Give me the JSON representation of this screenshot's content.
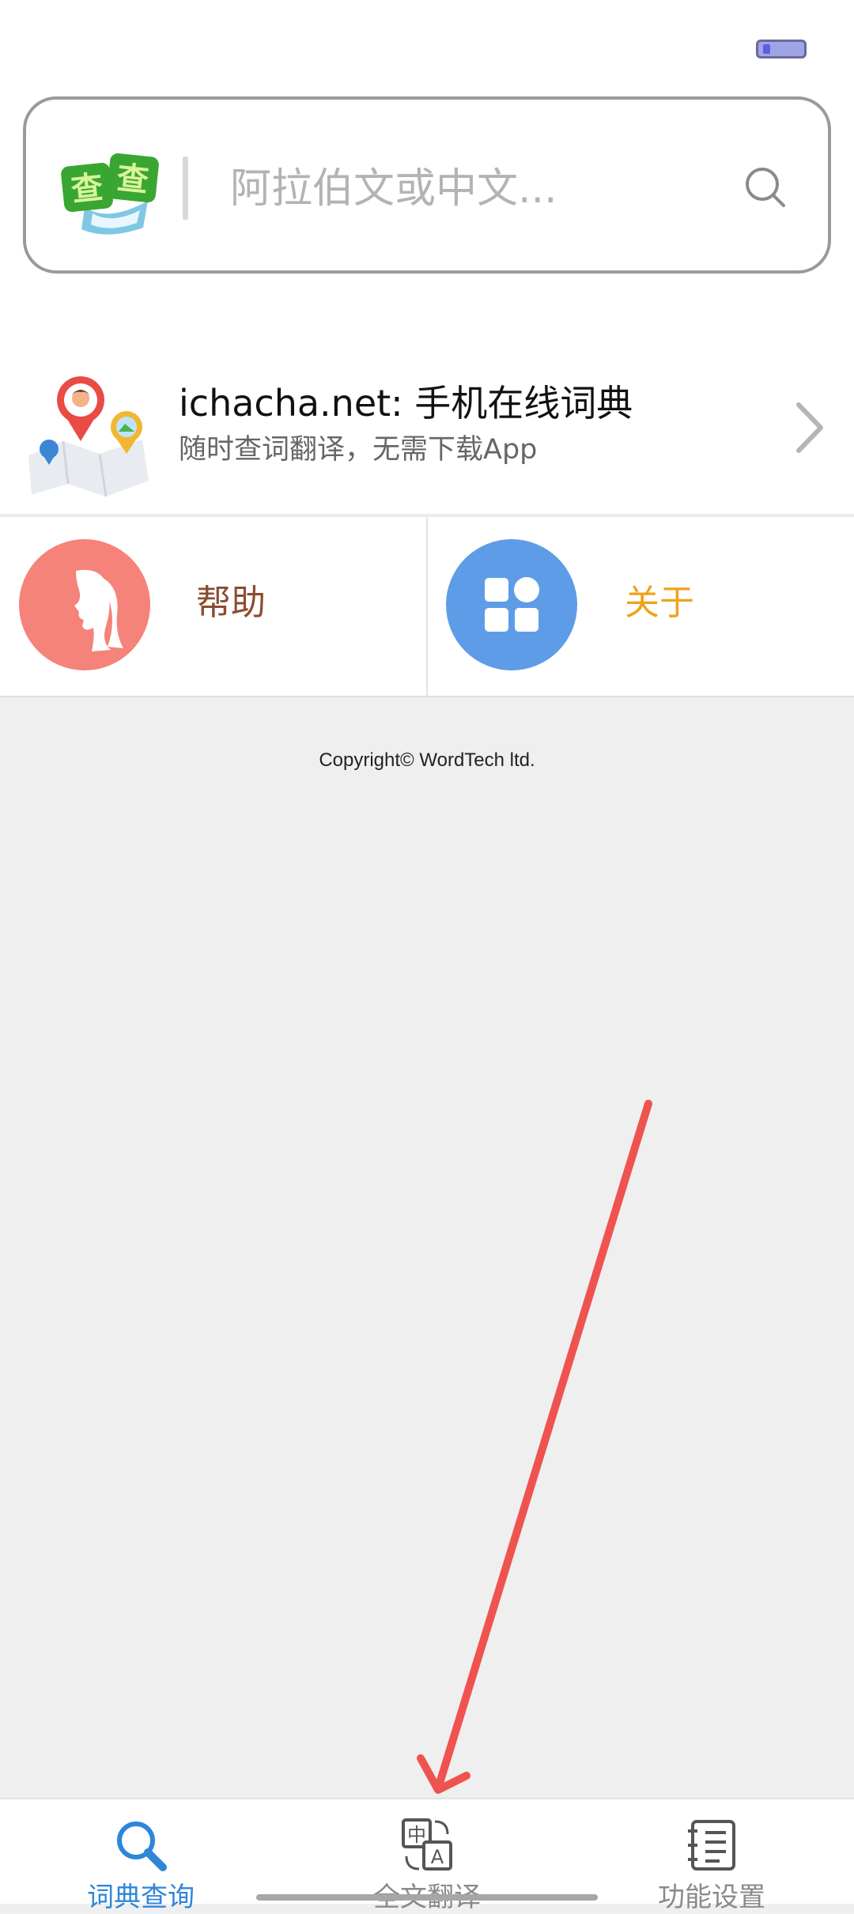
{
  "search": {
    "placeholder": "阿拉伯文或中文..."
  },
  "promo": {
    "title": "ichacha.net: 手机在线词典",
    "subtitle": "随时查词翻译，无需下载App"
  },
  "tiles": {
    "help_label": "帮助",
    "about_label": "关于"
  },
  "footer": {
    "copyright": "Copyright© WordTech ltd."
  },
  "tabbar": {
    "tabs": [
      {
        "label": "词典查询",
        "icon": "magnifier-icon",
        "active": true
      },
      {
        "label": "全文翻译",
        "icon": "translate-icon",
        "active": false
      },
      {
        "label": "功能设置",
        "icon": "notebook-icon",
        "active": false
      }
    ]
  },
  "colors": {
    "accent_blue": "#2f86d9",
    "help_circle": "#f5837a",
    "about_circle": "#5e9ce7",
    "help_text": "#8c4c2f",
    "about_text": "#f0a21a",
    "annotation_arrow": "#ef5350"
  }
}
